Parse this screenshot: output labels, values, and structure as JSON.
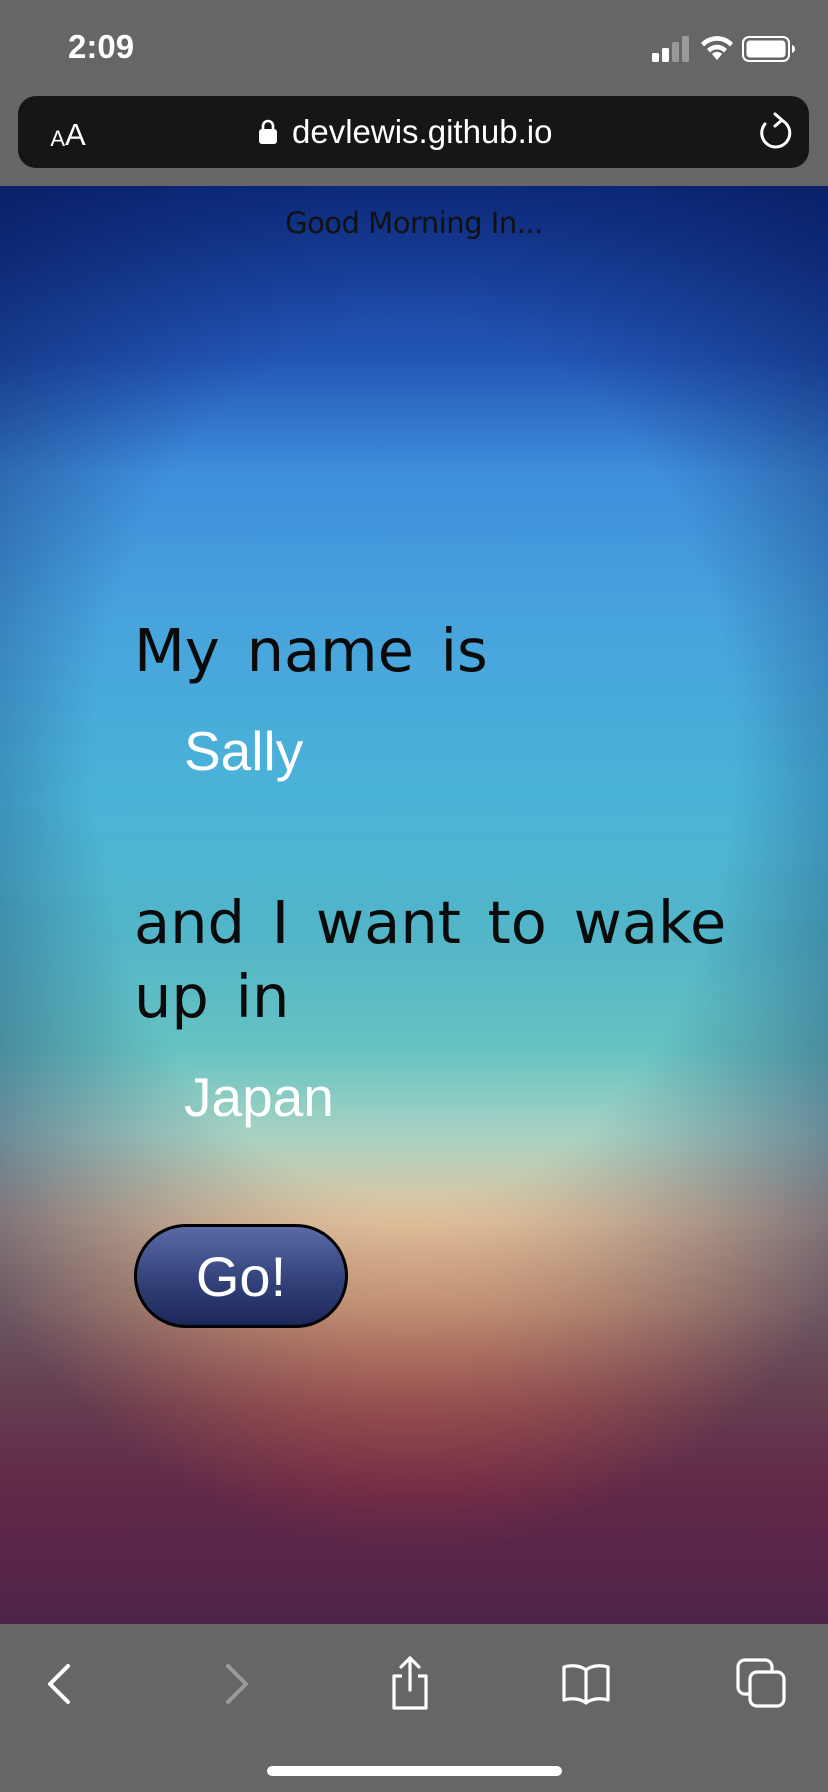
{
  "status_bar": {
    "time": "2:09"
  },
  "address_bar": {
    "text_size_small": "A",
    "text_size_large": "A",
    "url": "devlewis.github.io"
  },
  "page": {
    "header": "Good Morning In...",
    "name_prompt": "My name is",
    "name_value": "Sally",
    "place_prompt": "and I want to wake up in",
    "place_value": "Japan",
    "go_label": "Go!"
  },
  "colors": {
    "browser_chrome": "#666666",
    "address_bar": "#161616",
    "button_fill": "#33427a",
    "input_text": "#ffffff",
    "prompt_text": "#0a0a0a"
  },
  "icons": {
    "status": [
      "signal-icon",
      "wifi-icon",
      "battery-icon"
    ],
    "address_bar": [
      "lock-icon",
      "reload-icon"
    ],
    "toolbar": [
      "back-icon",
      "forward-icon",
      "share-icon",
      "bookmarks-icon",
      "tabs-icon"
    ]
  }
}
